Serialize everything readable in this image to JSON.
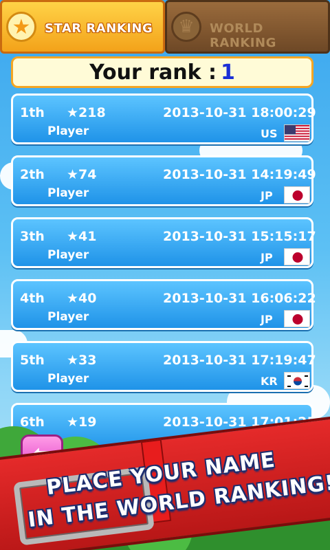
{
  "tabs": {
    "star_label": "STAR RANKING",
    "world_label": "WORLD RANKING"
  },
  "your_rank": {
    "label": "Your rank :",
    "value": "1"
  },
  "rows": [
    {
      "pos": "1th",
      "stars": "★218",
      "date": "2013-10-31  18:00:29",
      "player": "Player",
      "country": "US",
      "flag": "us-flag"
    },
    {
      "pos": "2th",
      "stars": "★74",
      "date": "2013-10-31  14:19:49",
      "player": "Player",
      "country": "JP",
      "flag": "jp-flag"
    },
    {
      "pos": "3th",
      "stars": "★41",
      "date": "2013-10-31  15:15:17",
      "player": "Player",
      "country": "JP",
      "flag": "jp-flag"
    },
    {
      "pos": "4th",
      "stars": "★40",
      "date": "2013-10-31  16:06:22",
      "player": "Player",
      "country": "JP",
      "flag": "jp-flag"
    },
    {
      "pos": "5th",
      "stars": "★33",
      "date": "2013-10-31  17:19:47",
      "player": "Player",
      "country": "KR",
      "flag": "kr-flag"
    },
    {
      "pos": "6th",
      "stars": "★19",
      "date": "2013-10-31  17:01:25",
      "player": "",
      "country": "",
      "flag": ""
    }
  ],
  "banner": {
    "line1": "PLACE YOUR NAME",
    "line2": "IN THE WORLD RANKING!"
  },
  "colors": {
    "tab_active": "#f3a21a",
    "tab_inactive": "#6e4826",
    "row_blue": "#1f93e8",
    "rank_number": "#1b2fd6",
    "banner_red": "#e52a2a"
  }
}
